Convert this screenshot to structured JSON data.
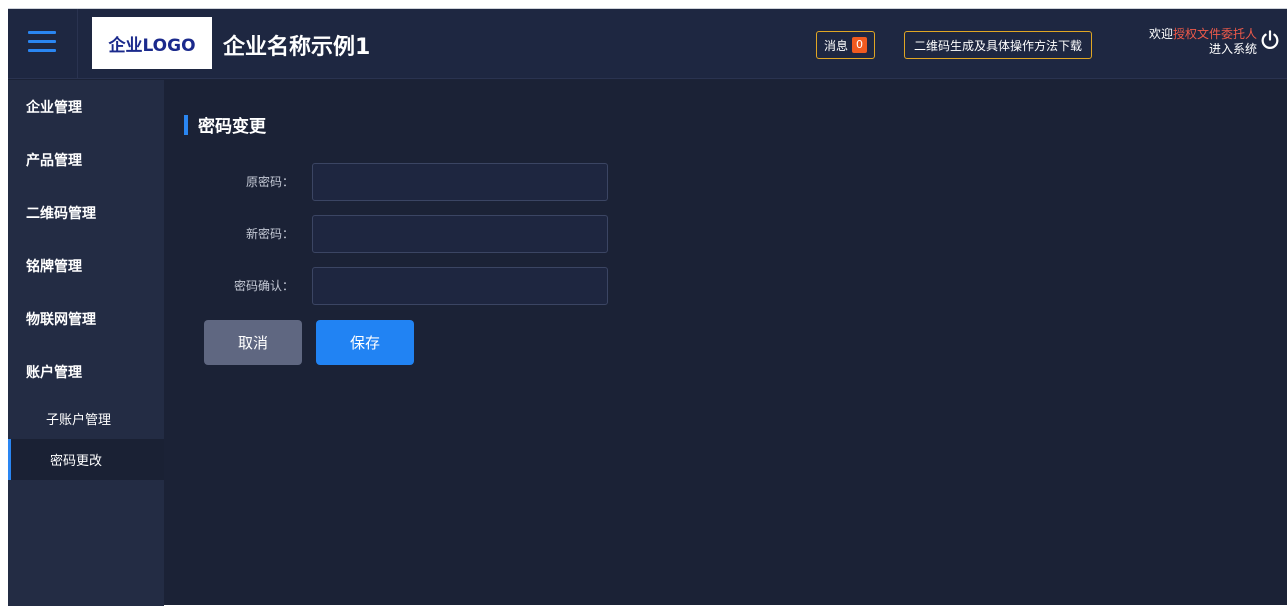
{
  "header": {
    "logo_text": "企业LOGO",
    "company_name": "企业名称示例1",
    "message_label": "消息",
    "message_count": "0",
    "qr_help_label": "二维码生成及具体操作方法下载",
    "welcome_prefix": "欢迎",
    "user_name": "授权文件委托人",
    "enter_system": "进入系统",
    "accent_color": "#2a86f2",
    "badge_border_color": "#e0a624",
    "menu_icon": "hamburger-menu-icon",
    "power_icon": "power-icon"
  },
  "sidebar": {
    "items": [
      {
        "label": "企业管理"
      },
      {
        "label": "产品管理"
      },
      {
        "label": "二维码管理"
      },
      {
        "label": "铭牌管理"
      },
      {
        "label": "物联网管理"
      },
      {
        "label": "账户管理"
      }
    ],
    "sub_items": [
      {
        "label": "子账户管理",
        "active": false
      },
      {
        "label": "密码更改",
        "active": true
      }
    ]
  },
  "main": {
    "title": "密码变更",
    "fields": [
      {
        "label": "原密码：",
        "value": "",
        "placeholder": ""
      },
      {
        "label": "新密码：",
        "value": "",
        "placeholder": ""
      },
      {
        "label": "密码确认：",
        "value": "",
        "placeholder": ""
      }
    ],
    "cancel_label": "取消",
    "save_label": "保存"
  }
}
